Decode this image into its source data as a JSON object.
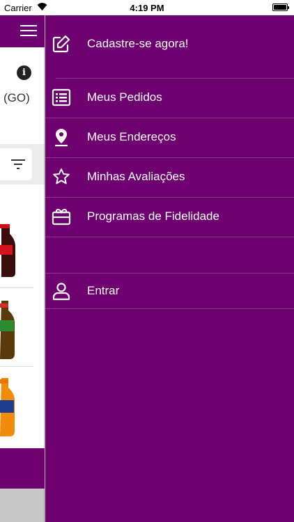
{
  "status_bar": {
    "carrier": "Carrier",
    "time": "4:19 PM"
  },
  "background": {
    "city_partial": "(GO)",
    "info_icon_glyph": "i"
  },
  "drawer": {
    "items": [
      {
        "label": "Cadastre-se agora!",
        "icon": "edit-icon"
      },
      {
        "label": "Meus Pedidos",
        "icon": "list-icon"
      },
      {
        "label": "Meus Endereços",
        "icon": "location-pin-icon"
      },
      {
        "label": "Minhas Avaliações",
        "icon": "star-icon"
      },
      {
        "label": "Programas de Fidelidade",
        "icon": "gift-card-icon"
      },
      {
        "label": "Entrar",
        "icon": "user-icon"
      }
    ]
  },
  "colors": {
    "brand_purple": "#6e0070",
    "divider": "rgba(255,255,255,0.22)"
  }
}
